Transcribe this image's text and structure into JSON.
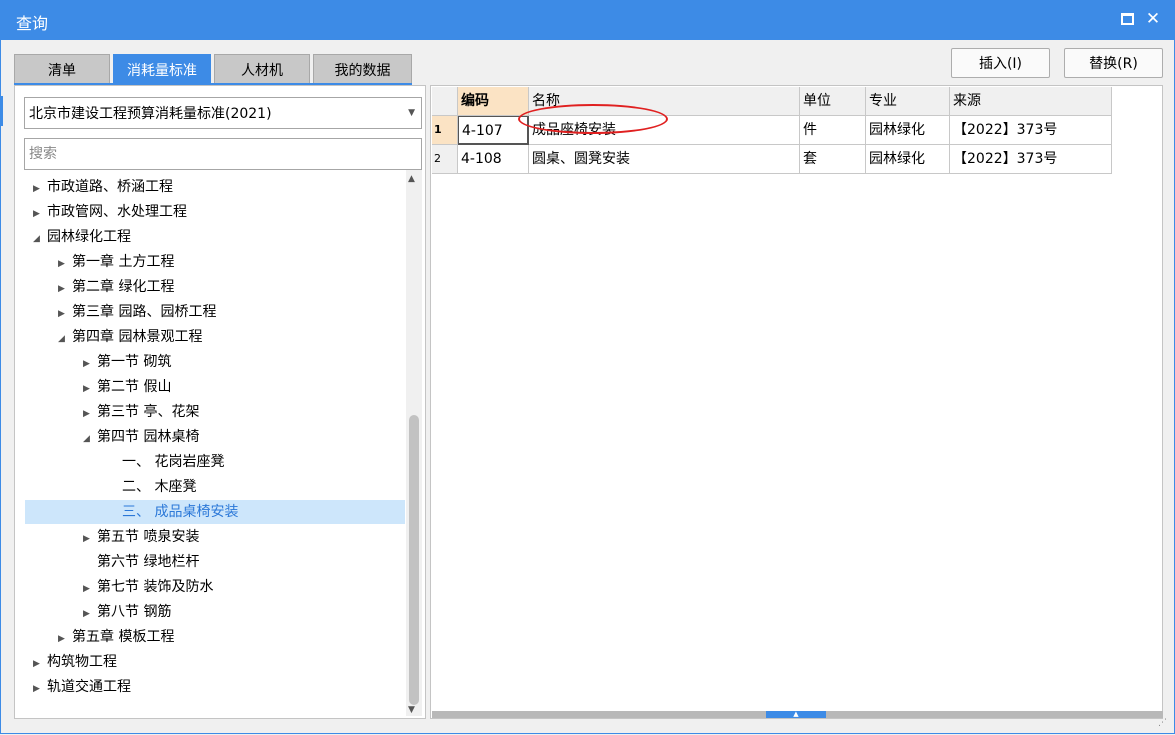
{
  "window": {
    "title": "查询"
  },
  "tabs": [
    "清单",
    "消耗量标准",
    "人材机",
    "我的数据"
  ],
  "active_tab": "消耗量标准",
  "buttons": {
    "insert": "插入(I)",
    "replace": "替换(R)"
  },
  "standard_select": {
    "value": "北京市建设工程预算消耗量标准(2021)"
  },
  "search": {
    "placeholder": "搜索"
  },
  "tree": [
    {
      "label": "市政道路、桥涵工程",
      "level": 0,
      "toggle": "collapsed"
    },
    {
      "label": "市政管网、水处理工程",
      "level": 0,
      "toggle": "collapsed"
    },
    {
      "label": "园林绿化工程",
      "level": 0,
      "toggle": "expanded"
    },
    {
      "label": "第一章 土方工程",
      "level": 1,
      "toggle": "collapsed"
    },
    {
      "label": "第二章 绿化工程",
      "level": 1,
      "toggle": "collapsed"
    },
    {
      "label": "第三章 园路、园桥工程",
      "level": 1,
      "toggle": "collapsed"
    },
    {
      "label": "第四章 园林景观工程",
      "level": 1,
      "toggle": "expanded"
    },
    {
      "label": "第一节 砌筑",
      "level": 2,
      "toggle": "collapsed"
    },
    {
      "label": "第二节 假山",
      "level": 2,
      "toggle": "collapsed"
    },
    {
      "label": "第三节 亭、花架",
      "level": 2,
      "toggle": "collapsed"
    },
    {
      "label": "第四节 园林桌椅",
      "level": 2,
      "toggle": "expanded"
    },
    {
      "label": "一、  花岗岩座凳",
      "level": 3,
      "toggle": "none"
    },
    {
      "label": "二、  木座凳",
      "level": 3,
      "toggle": "none"
    },
    {
      "label": "三、  成品桌椅安装",
      "level": 3,
      "toggle": "none",
      "selected": true
    },
    {
      "label": "第五节 喷泉安装",
      "level": 2,
      "toggle": "collapsed"
    },
    {
      "label": "第六节 绿地栏杆",
      "level": 2,
      "toggle": "none"
    },
    {
      "label": "第七节 装饰及防水",
      "level": 2,
      "toggle": "collapsed"
    },
    {
      "label": "第八节 钢筋",
      "level": 2,
      "toggle": "collapsed"
    },
    {
      "label": "第五章 模板工程",
      "level": 1,
      "toggle": "collapsed"
    },
    {
      "label": "构筑物工程",
      "level": 0,
      "toggle": "collapsed"
    },
    {
      "label": "轨道交通工程",
      "level": 0,
      "toggle": "collapsed"
    }
  ],
  "table": {
    "columns": [
      "编码",
      "名称",
      "单位",
      "专业",
      "来源"
    ],
    "rows": [
      {
        "num": "1",
        "code": "4-107",
        "name": "成品座椅安装",
        "unit": "件",
        "major": "园林绿化",
        "source": "【2022】373号"
      },
      {
        "num": "2",
        "code": "4-108",
        "name": "圆桌、圆凳安装",
        "unit": "套",
        "major": "园林绿化",
        "source": "【2022】373号"
      }
    ]
  },
  "icons": {
    "maximize": "maximize-icon",
    "close": "close-icon",
    "collapsed": "triangle-right-icon",
    "expanded": "triangle-down-icon",
    "dropdown": "chevron-down-icon",
    "grip": "resize-grip-icon"
  },
  "colors": {
    "accent": "#3d8be6",
    "selection": "#cde6fb",
    "current_header": "#fbe3c4",
    "annotation": "#e02020"
  }
}
